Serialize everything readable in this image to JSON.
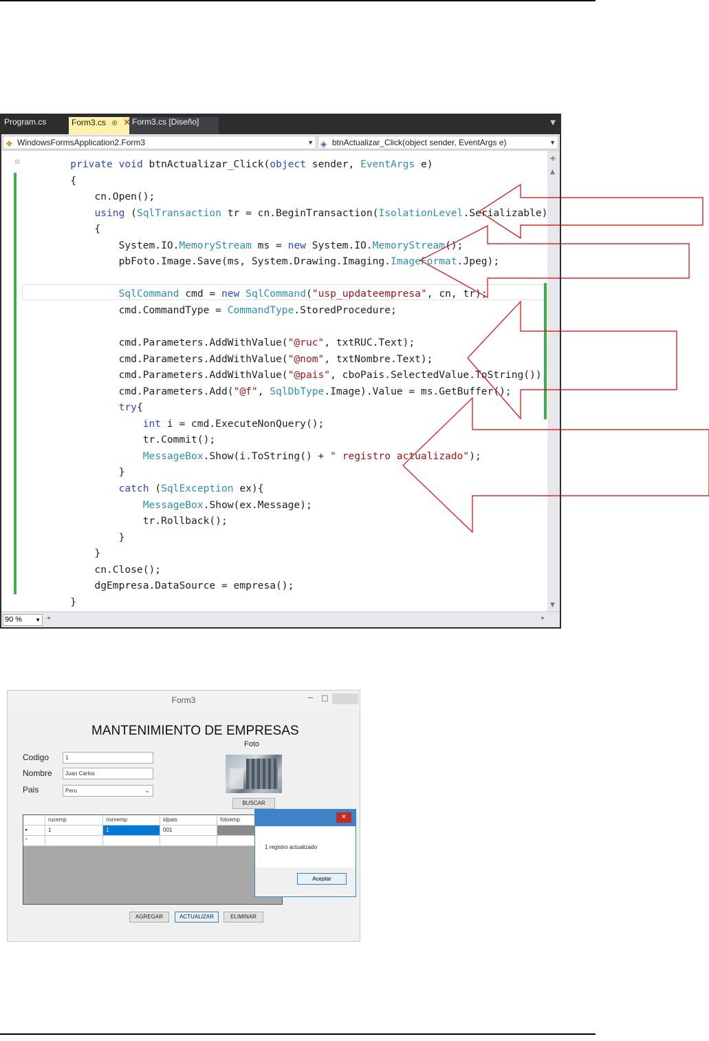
{
  "ide": {
    "tabs": [
      {
        "label": "Program.cs",
        "active": false
      },
      {
        "label": "Form3.cs",
        "active": true,
        "pin": "⊕",
        "close": "✕"
      },
      {
        "label": "Form3.cs [Diseño]",
        "active": false
      }
    ],
    "nav_class": "WindowsFormsApplication2.Form3",
    "nav_member": "btnActualizar_Click(object sender, EventArgs e)",
    "zoom": "90 %",
    "code_lines": [
      [
        {
          "t": "        ",
          "c": ""
        },
        {
          "t": "private",
          "c": "kw"
        },
        {
          "t": " ",
          "c": ""
        },
        {
          "t": "void",
          "c": "kw"
        },
        {
          "t": " btnActualizar_Click(",
          "c": ""
        },
        {
          "t": "object",
          "c": "kw"
        },
        {
          "t": " sender, ",
          "c": ""
        },
        {
          "t": "EventArgs",
          "c": "ty"
        },
        {
          "t": " e)",
          "c": ""
        }
      ],
      [
        {
          "t": "        {",
          "c": ""
        }
      ],
      [
        {
          "t": "            cn.Open();",
          "c": ""
        }
      ],
      [
        {
          "t": "            ",
          "c": ""
        },
        {
          "t": "using",
          "c": "kw"
        },
        {
          "t": " (",
          "c": ""
        },
        {
          "t": "SqlTransaction",
          "c": "ty"
        },
        {
          "t": " tr = cn.BeginTransaction(",
          "c": ""
        },
        {
          "t": "IsolationLevel",
          "c": "ty"
        },
        {
          "t": ".Serializable))",
          "c": ""
        }
      ],
      [
        {
          "t": "            {",
          "c": ""
        }
      ],
      [
        {
          "t": "                System.IO.",
          "c": ""
        },
        {
          "t": "MemoryStream",
          "c": "ty"
        },
        {
          "t": " ms = ",
          "c": ""
        },
        {
          "t": "new",
          "c": "kw"
        },
        {
          "t": " System.IO.",
          "c": ""
        },
        {
          "t": "MemoryStream",
          "c": "ty"
        },
        {
          "t": "();",
          "c": ""
        }
      ],
      [
        {
          "t": "                pbFoto.Image.Save(ms, System.Drawing.Imaging.",
          "c": ""
        },
        {
          "t": "ImageFormat",
          "c": "ty"
        },
        {
          "t": ".Jpeg);",
          "c": ""
        }
      ],
      [
        {
          "t": "",
          "c": ""
        }
      ],
      [
        {
          "t": "                ",
          "c": ""
        },
        {
          "t": "SqlCommand",
          "c": "ty"
        },
        {
          "t": " cmd = ",
          "c": ""
        },
        {
          "t": "new",
          "c": "kw"
        },
        {
          "t": " ",
          "c": ""
        },
        {
          "t": "SqlCommand",
          "c": "ty"
        },
        {
          "t": "(",
          "c": ""
        },
        {
          "t": "\"usp_updateempresa\"",
          "c": "st"
        },
        {
          "t": ", cn, tr);",
          "c": ""
        }
      ],
      [
        {
          "t": "                cmd.CommandType = ",
          "c": ""
        },
        {
          "t": "CommandType",
          "c": "ty"
        },
        {
          "t": ".StoredProcedure;",
          "c": ""
        }
      ],
      [
        {
          "t": "",
          "c": ""
        }
      ],
      [
        {
          "t": "                cmd.Parameters.AddWithValue(",
          "c": ""
        },
        {
          "t": "\"@ruc\"",
          "c": "st"
        },
        {
          "t": ", txtRUC.Text);",
          "c": ""
        }
      ],
      [
        {
          "t": "                cmd.Parameters.AddWithValue(",
          "c": ""
        },
        {
          "t": "\"@nom\"",
          "c": "st"
        },
        {
          "t": ", txtNombre.Text);",
          "c": ""
        }
      ],
      [
        {
          "t": "                cmd.Parameters.AddWithValue(",
          "c": ""
        },
        {
          "t": "\"@pais\"",
          "c": "st"
        },
        {
          "t": ", cboPais.SelectedValue.ToString());",
          "c": ""
        }
      ],
      [
        {
          "t": "                cmd.Parameters.Add(",
          "c": ""
        },
        {
          "t": "\"@f\"",
          "c": "st"
        },
        {
          "t": ", ",
          "c": ""
        },
        {
          "t": "SqlDbType",
          "c": "ty"
        },
        {
          "t": ".Image).Value = ms.GetBuffer();",
          "c": ""
        }
      ],
      [
        {
          "t": "                ",
          "c": ""
        },
        {
          "t": "try",
          "c": "kw"
        },
        {
          "t": "{",
          "c": ""
        }
      ],
      [
        {
          "t": "                    ",
          "c": ""
        },
        {
          "t": "int",
          "c": "kw"
        },
        {
          "t": " i = cmd.ExecuteNonQuery();",
          "c": ""
        }
      ],
      [
        {
          "t": "                    tr.Commit();",
          "c": ""
        }
      ],
      [
        {
          "t": "                    ",
          "c": ""
        },
        {
          "t": "MessageBox",
          "c": "ty"
        },
        {
          "t": ".Show(i.ToString() + ",
          "c": ""
        },
        {
          "t": "\" registro actualizado\"",
          "c": "st"
        },
        {
          "t": ");",
          "c": ""
        }
      ],
      [
        {
          "t": "                }",
          "c": ""
        }
      ],
      [
        {
          "t": "                ",
          "c": ""
        },
        {
          "t": "catch",
          "c": "kw"
        },
        {
          "t": " (",
          "c": ""
        },
        {
          "t": "SqlException",
          "c": "ty"
        },
        {
          "t": " ex){",
          "c": ""
        }
      ],
      [
        {
          "t": "                    ",
          "c": ""
        },
        {
          "t": "MessageBox",
          "c": "ty"
        },
        {
          "t": ".Show(ex.Message);",
          "c": ""
        }
      ],
      [
        {
          "t": "                    tr.Rollback();",
          "c": ""
        }
      ],
      [
        {
          "t": "                }",
          "c": ""
        }
      ],
      [
        {
          "t": "            }",
          "c": ""
        }
      ],
      [
        {
          "t": "            cn.Close();",
          "c": ""
        }
      ],
      [
        {
          "t": "            dgEmpresa.DataSource = empresa();",
          "c": ""
        }
      ],
      [
        {
          "t": "        }",
          "c": ""
        }
      ]
    ],
    "colors": {
      "keyword": "#2b46c8",
      "type": "#2b91af",
      "string": "#a31515",
      "change_bar": "#3cb043",
      "arrow": "#e00000"
    }
  },
  "form": {
    "title": "Form3",
    "heading": "MANTENIMIENTO DE EMPRESAS",
    "foto_label": "Foto",
    "codigo_label": "Codigo",
    "codigo_value": "1",
    "nombre_label": "Nombre",
    "nombre_value": "Juan Carlos",
    "pais_label": "Pais",
    "pais_value": "Peru",
    "buscar_label": "BUSCAR",
    "grid": {
      "headers": [
        "rucemp",
        "nomemp",
        "idpais",
        "fotoemp"
      ],
      "rows": [
        {
          "marker": "▸",
          "cells": [
            "1",
            "1",
            "001",
            ""
          ]
        },
        {
          "marker": "*",
          "cells": [
            "",
            "",
            "",
            ""
          ]
        }
      ]
    },
    "buttons": {
      "agregar": "AGREGAR",
      "actualizar": "ACTUALIZAR",
      "eliminar": "ELIMINAR"
    },
    "messagebox": {
      "text": "1 registro actualizado",
      "ok": "Aceptar",
      "close": "✕"
    }
  }
}
